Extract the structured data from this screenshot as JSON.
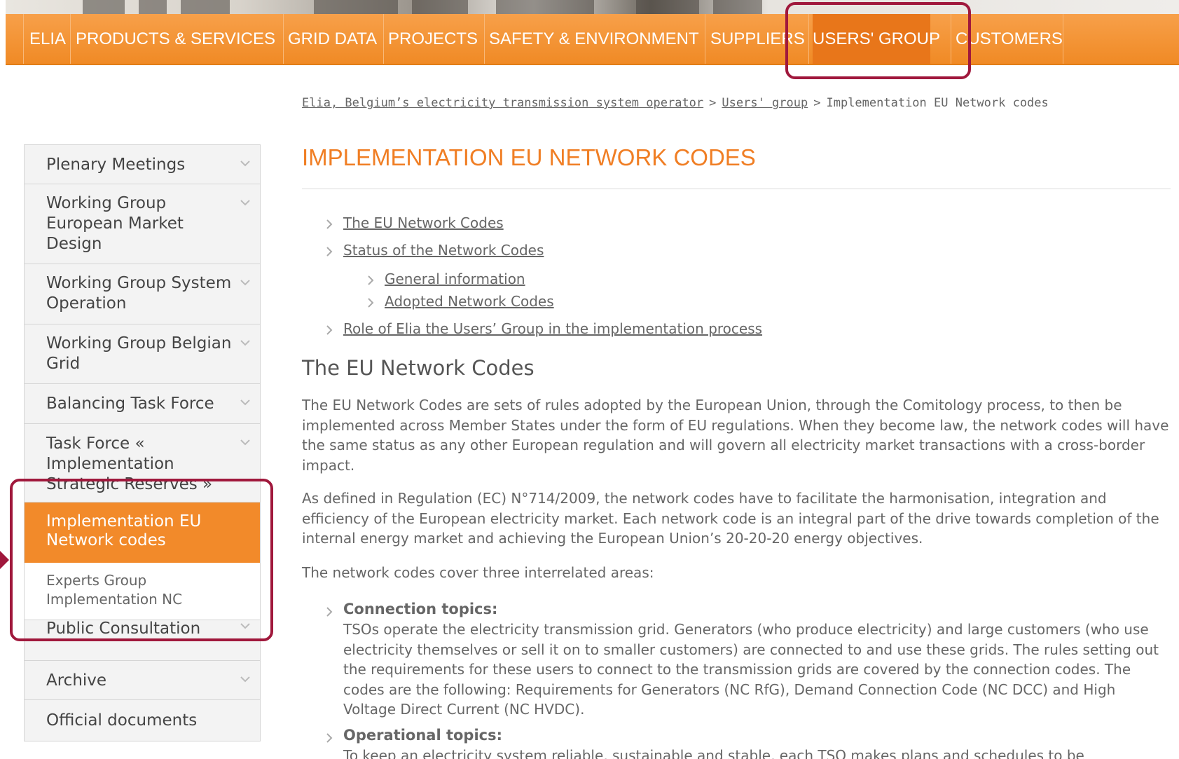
{
  "nav": {
    "items": [
      "ELIA",
      "PRODUCTS & SERVICES",
      "GRID DATA",
      "PROJECTS",
      "SAFETY & ENVIRONMENT",
      "SUPPLIERS",
      "USERS' GROUP",
      "CUSTOMERS"
    ]
  },
  "breadcrumb": {
    "home": "Elia, Belgium’s electricity transmission system operator",
    "sep": ">",
    "section": "Users' group",
    "current": "Implementation EU Network codes"
  },
  "sidebar": {
    "items": [
      {
        "label": "Plenary Meetings"
      },
      {
        "label": "Working Group European Market Design"
      },
      {
        "label": "Working Group System Operation"
      },
      {
        "label": "Working Group Belgian Grid"
      },
      {
        "label": "Balancing Task Force"
      },
      {
        "label": "Task Force « Implementation Strategic Reserves »"
      },
      {
        "label": "Implementation EU Network codes"
      },
      {
        "label": "Experts Group Implementation NC"
      },
      {
        "label": "Public Consultation"
      },
      {
        "label": "Archive"
      },
      {
        "label": "Official documents"
      }
    ]
  },
  "main": {
    "title": "IMPLEMENTATION EU NETWORK CODES",
    "toc": [
      "The EU Network Codes",
      "Status of the Network Codes",
      "General information",
      "Adopted Network Codes",
      "Role of Elia the Users’ Group in the implementation process"
    ],
    "section_heading": "The EU Network Codes",
    "para1": "The EU Network Codes are sets of rules adopted by the European Union, through the Comitology process, to then be implemented across Member States under the form of EU regulations. When they become law, the network codes will have the same status as any other European regulation and will govern all electricity market transactions with a cross-border impact.",
    "para2": "As defined in Regulation (EC) N°714/2009, the network codes have to facilitate the harmonisation, integration and efficiency of the European electricity market. Each network code is an integral part of the drive towards completion of the internal energy market and achieving the European Union’s 20-20-20 energy objectives.",
    "para3": "The network codes cover three interrelated areas:",
    "topic1_title": "Connection topics:",
    "topic1_body": "TSOs operate the electricity transmission grid. Generators (who produce electricity) and large customers (who use electricity themselves or sell it on to smaller customers) are connected to and use these grids. The rules setting out the requirements for these users to connect to the transmission grids are covered by the connection codes. The codes are the following: Requirements for Generators (NC RfG), Demand Connection Code (NC DCC) and High Voltage Direct Current (NC HVDC).",
    "topic2_title": "Operational topics:",
    "topic2_body": "To keep an electricity system reliable, sustainable and stable, each TSO makes plans and schedules to be"
  },
  "colors": {
    "accent": "#f07e24",
    "nav_bg": "#f08a25",
    "highlight": "#a0183c"
  }
}
